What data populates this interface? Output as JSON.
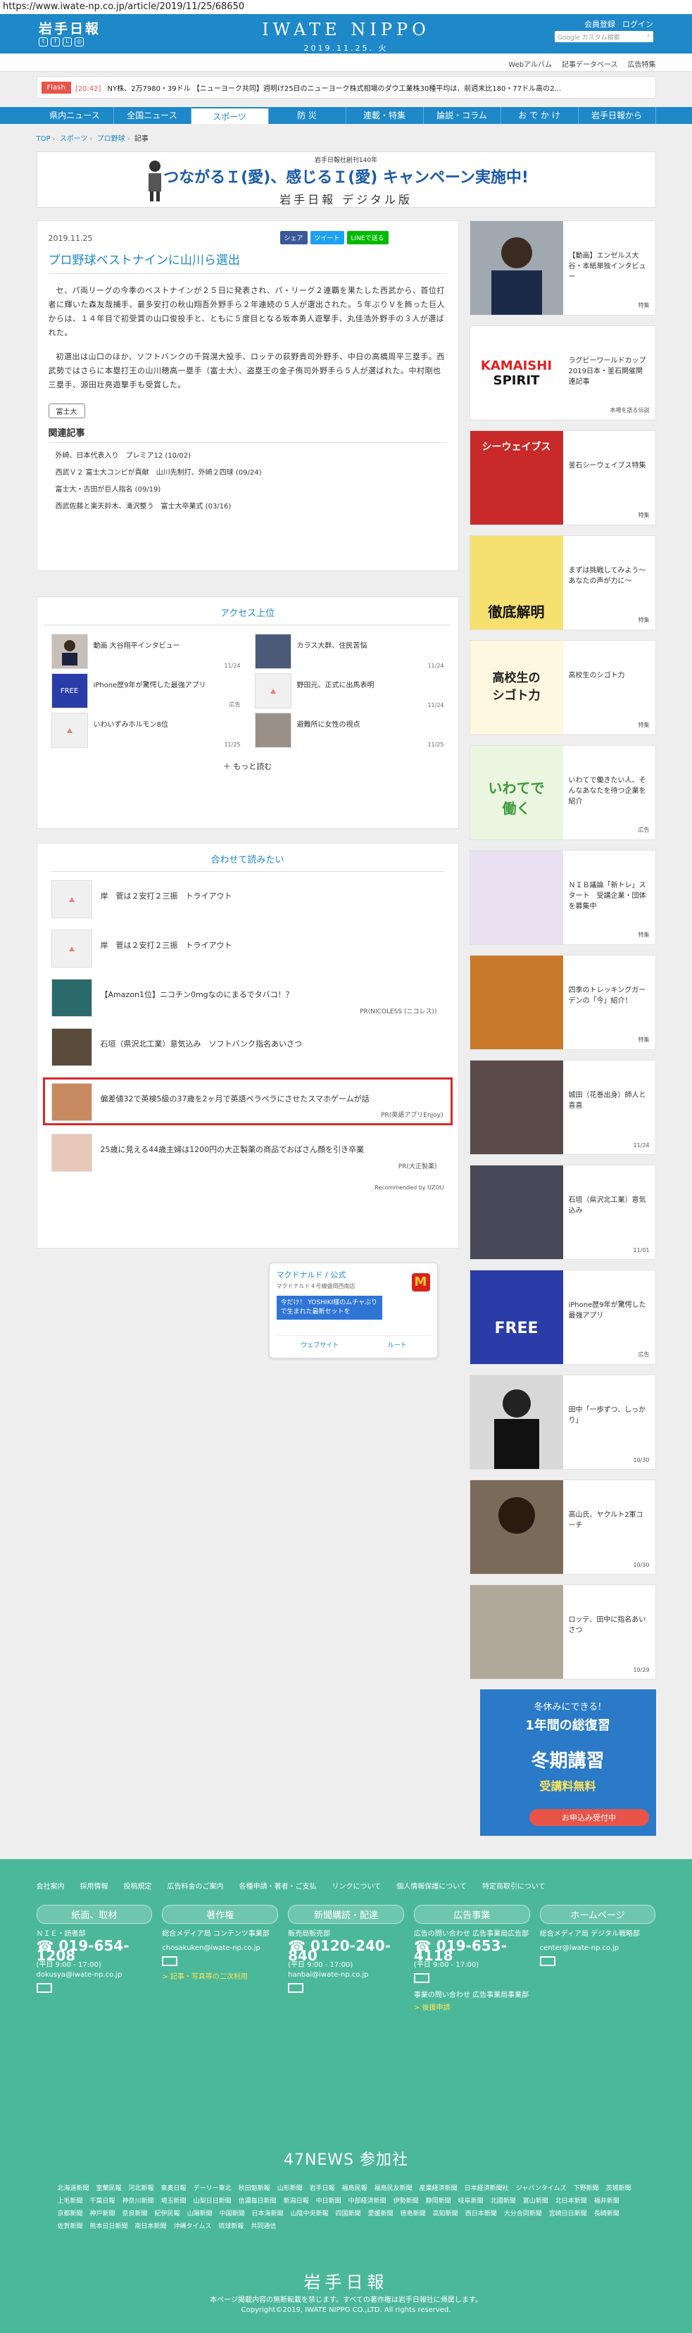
{
  "url": "https://www.iwate-np.co.jp/article/2019/11/25/68650",
  "header": {
    "logo": "岩手日報",
    "brand": "IWATE NIPPO",
    "date": "2019.11.25. 火",
    "links": [
      "会員登録",
      "ログイン"
    ],
    "search_placeholder": "Google カスタム検索"
  },
  "subnav": [
    "Webアルバム",
    "記事データベース",
    "広告特集"
  ],
  "flash": {
    "label": "Flash",
    "time": "[20:42]",
    "text": "NY株、2万7980・39ドル 【ニューヨーク共同】週明け25日のニューヨーク株式相場のダウ工業株30種平均は、前週末比180・77ドル高の2..."
  },
  "mainnav": [
    "県内ニュース",
    "全国ニュース",
    "スポーツ",
    "防 災",
    "連載・特集",
    "論説・コラム",
    "お で か け",
    "岩手日報から"
  ],
  "breadcrumb": [
    "TOP",
    "スポーツ",
    "プロ野球",
    "記事"
  ],
  "banner": {
    "small": "岩手日報社創刊140年",
    "big": "つながるＩ(愛)、感じるＩ(愛) キャンペーン実施中!",
    "sub": "岩手日報 デジタル版"
  },
  "article": {
    "date": "2019.11.25",
    "title": "プロ野球ベストナインに山川ら選出",
    "share": [
      "シェア",
      "ツイート",
      "LINEで送る"
    ],
    "body": [
      "セ、パ両リーグの今季のベストナインが２５日に発表され、パ・リーグ２連覇を果たした西武から、首位打者に輝いた森友哉捕手、最多安打の秋山翔吾外野手ら２年連続の５人が選出された。５年ぶりＶを飾った巨人からは、１４年目で初受賞の山口俊投手と、ともに５度目となる坂本勇人遊撃手、丸佳浩外野手の３人が選ばれた。",
      "初選出は山口のほか、ソフトバンクの千賀滉大投手、ロッテの荻野貴司外野手、中日の高橋周平三塁手。西武勢ではさらに本塁打王の山川穂高一塁手（富士大）、盗塁王の金子侑司外野手ら５人が選ばれた。中村剛也三塁手、源田壮亮遊撃手も受賞した。"
    ],
    "tag": "富士大",
    "related_title": "関連記事",
    "related": [
      "外崎、日本代表入り　プレミア12 (10/02)",
      "西武Ｖ２ 富士大コンビが貢献　山川先制打、外崎２四球 (09/24)",
      "富士大・古田が巨人指名 (09/19)",
      "西武佐藤と楽天鈴木、滝沢整う　富士大卒業式 (03/16)"
    ]
  },
  "access": {
    "title": "アクセス上位",
    "items": [
      {
        "text": "動画 大谷翔平インタビュー",
        "date": "11/24"
      },
      {
        "text": "カラス大群、住民苦悩",
        "date": "11/24"
      },
      {
        "text": "iPhone歴9年が驚愕した最強アプリ",
        "date": "広告"
      },
      {
        "text": "野田元、正式に出馬表明",
        "date": "11/24"
      },
      {
        "text": "いわいずみホルモン8位",
        "date": "11/25"
      },
      {
        "text": "避難所に女性の視点",
        "date": "11/25"
      }
    ],
    "more": "もっと読む"
  },
  "together": {
    "title": "合わせて読みたい",
    "items": [
      {
        "text": "岸　菅は２安打２三振　トライアウト",
        "sub": ""
      },
      {
        "text": "岸　菅は２安打２三振　トライアウト",
        "sub": ""
      },
      {
        "text": "【Amazon1位】ニコチン0mgなのにまるでタバコ！？",
        "sub": "PR(NICOLESS (ニコレス))"
      },
      {
        "text": "石垣（県沢北工業）意気込み　ソフトバンク指名あいさつ",
        "sub": ""
      },
      {
        "text": "偏差値32で英検5級の37歳を2ヶ月で英語ペラペラにさせたスマホゲームが話",
        "sub": "PR(英語アプリEnjoy)"
      },
      {
        "text": "25歳に見える44歳主婦は1200円の大正製薬の商品でおばさん顔を引き卒業",
        "sub": "PR(大正製薬)"
      }
    ],
    "recommend": "Recommended by UZOU"
  },
  "mcd": {
    "name": "マクドナルド / 公式",
    "addr": "マクドナルド４号線盛岡西南店",
    "promo": "今だけ！ YOSHIKI様のムチャぶりで生まれた最新セットを",
    "m": "M",
    "btn1": "ウェブサイト",
    "btn2": "ルート"
  },
  "sidebar": [
    {
      "text": "【動画】エンゼルス大谷・本紙単独インタビュー",
      "date": "特集"
    },
    {
      "text": "ラグビーワールドカップ2019日本・釜石開催関連記事",
      "date": "本場を語る伝説"
    },
    {
      "text": "釜石シーウェイブス特集",
      "date": "特集"
    },
    {
      "text": "まずは挑戦してみよう～あなたの声が力に～",
      "date": "特集"
    },
    {
      "text": "高校生のシゴト力",
      "date": "特集"
    },
    {
      "text": "いわてで働きたい人、そんなあなたを待つ企業を紹介",
      "date": "広告"
    },
    {
      "text": "ＮＩＢ議論「新トレ」スタート　受講企業・団体を募集中",
      "date": "特集"
    },
    {
      "text": "四季のトレッキングガーデンの「今」紹介！",
      "date": "特集"
    },
    {
      "text": "城田（花巻出身）師人と喜喜",
      "date": "11/24"
    },
    {
      "text": "石垣（県沢北工業）意気込み",
      "date": "11/01"
    },
    {
      "text": "iPhone歴9年が驚愕した最強アプリ",
      "date": "広告"
    },
    {
      "text": "田中「一歩ずつ、しっかり」",
      "date": "10/30"
    },
    {
      "text": "高山氏、ヤクルト2軍コーチ",
      "date": "10/30"
    },
    {
      "text": "ロッテ、田中に指名あいさつ",
      "date": "10/29"
    }
  ],
  "ad": {
    "line1": "冬休みにできる!",
    "line2": "1年間の総復習",
    "line3": "冬期講習",
    "line4": "受講料無料",
    "line5": "お申込み受付中"
  },
  "footer": {
    "links": [
      "会社案内",
      "採用情報",
      "投稿規定",
      "広告料金のご案内",
      "各種申請・著者・ご支払",
      "リンクについて",
      "個人情報保護について",
      "特定商取引について"
    ],
    "cols": [
      {
        "head": "紙面、取材",
        "label": "ＮＩＥ・読者部",
        "tel": "019-654-1208",
        "hours": "(平日 9:00 - 17:00)",
        "mail": "dokusya@iwate-np.co.jp",
        "extra": ""
      },
      {
        "head": "著作権",
        "label": "総合メディア局 コンテンツ事業部",
        "tel": "",
        "hours": "",
        "mail": "chosakuken@iwate-np.co.jp",
        "extra": "> 記事・写真等の二次利用"
      },
      {
        "head": "新聞購読・配達",
        "label": "販売局販売部",
        "tel": "0120-240-840",
        "hours": "(平日 9:00 - 17:00)",
        "mail": "hanbai@iwate-np.co.jp",
        "extra": ""
      },
      {
        "head": "広告事業",
        "label": "広告の問い合わせ 広告事業局広告部",
        "tel": "019-653-4118",
        "hours": "(平日 9:00 - 17:00)",
        "mail": "事業の問い合わせ 広告事業局事業部",
        "extra": "> 後援申請"
      },
      {
        "head": "ホームページ",
        "label": "総合メディア局 デジタル戦略部",
        "tel": "",
        "hours": "",
        "mail": "center@iwate-np.co.jp",
        "extra": ""
      }
    ],
    "title47": "47NEWS 参加社",
    "papers": [
      "北海道新聞",
      "室蘭民報",
      "河北新報",
      "東奥日報",
      "デーリー東北",
      "秋田魁新報",
      "山形新聞",
      "岩手日報",
      "福島民報",
      "福島民友新聞",
      "産業経済新聞",
      "日本経済新聞社",
      "ジャパンタイムズ",
      "下野新聞",
      "茨城新聞",
      "上毛新聞",
      "千葉日報",
      "神奈川新聞",
      "埼玉新聞",
      "山梨日日新聞",
      "信濃毎日新聞",
      "新潟日報",
      "中日新聞",
      "中部経済新聞",
      "伊勢新聞",
      "静岡新聞",
      "岐阜新聞",
      "北國新聞",
      "富山新聞",
      "北日本新聞",
      "福井新聞",
      "京都新聞",
      "神戸新聞",
      "奈良新聞",
      "紀伊民報",
      "山陽新聞",
      "中国新聞",
      "日本海新聞",
      "山陰中央新報",
      "四国新聞",
      "愛媛新聞",
      "徳島新聞",
      "高知新聞",
      "西日本新聞",
      "大分合同新聞",
      "宮崎日日新聞",
      "長崎新聞",
      "佐賀新聞",
      "熊本日日新聞",
      "南日本新聞",
      "沖縄タイムス",
      "琉球新報",
      "共同通信"
    ],
    "logo": "岩手日報",
    "copy1": "本ページ掲載内容の無断転載を禁じます。すべての著作権は岩手日報社に帰属します。",
    "copy2": "Copyright©2019, IWATE NIPPO CO.,LTD. All rights reserved."
  }
}
